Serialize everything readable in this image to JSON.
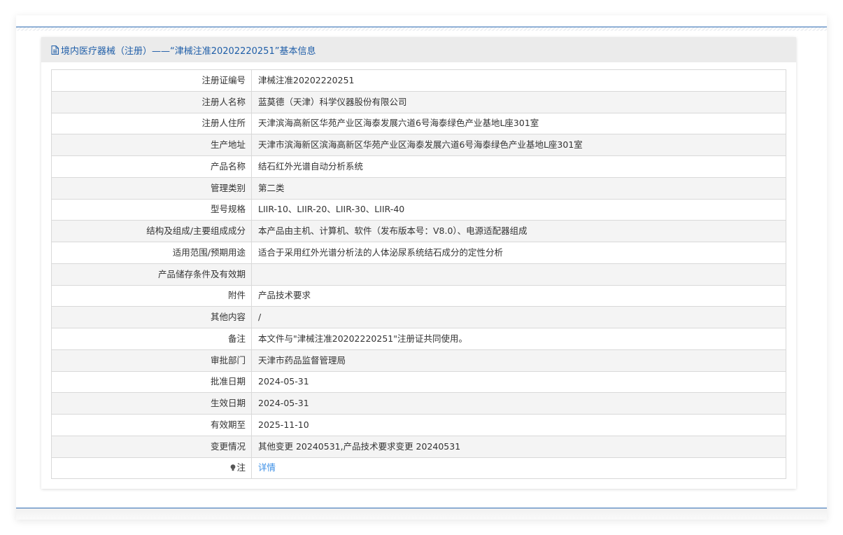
{
  "header": {
    "title": "境内医疗器械（注册）——“津械注准20202220251”基本信息"
  },
  "rows": [
    {
      "label": "注册证编号",
      "value": "津械注准20202220251"
    },
    {
      "label": "注册人名称",
      "value": "蓝莫德（天津）科学仪器股份有限公司"
    },
    {
      "label": "注册人住所",
      "value": "天津滨海高新区华苑产业区海泰发展六道6号海泰绿色产业基地L座301室"
    },
    {
      "label": "生产地址",
      "value": "天津市滨海新区滨海高新区华苑产业区海泰发展六道6号海泰绿色产业基地L座301室"
    },
    {
      "label": "产品名称",
      "value": "结石红外光谱自动分析系统"
    },
    {
      "label": "管理类别",
      "value": "第二类"
    },
    {
      "label": "型号规格",
      "value": "LIIR-10、LIIR-20、LIIR-30、LIIR-40"
    },
    {
      "label": "结构及组成/主要组成成分",
      "value": "本产品由主机、计算机、软件（发布版本号：V8.0）、电源适配器组成"
    },
    {
      "label": "适用范围/预期用途",
      "value": "适合于采用红外光谱分析法的人体泌尿系统结石成分的定性分析"
    },
    {
      "label": "产品储存条件及有效期",
      "value": ""
    },
    {
      "label": "附件",
      "value": "产品技术要求"
    },
    {
      "label": "其他内容",
      "value": "/"
    },
    {
      "label": "备注",
      "value": "本文件与\"津械注准20202220251\"注册证共同使用。"
    },
    {
      "label": "审批部门",
      "value": "天津市药品监督管理局"
    },
    {
      "label": "批准日期",
      "value": "2024-05-31"
    },
    {
      "label": "生效日期",
      "value": "2024-05-31"
    },
    {
      "label": "有效期至",
      "value": "2025-11-10"
    },
    {
      "label": "变更情况",
      "value": "其他变更 20240531,产品技术要求变更 20240531"
    }
  ],
  "note_row": {
    "icon": "bulb-icon",
    "label": "注",
    "link_text": "详情"
  },
  "colors": {
    "accent": "#1f5ea8",
    "link": "#3a8ee6",
    "header_bg": "#ebebeb",
    "row_alt": "#f4f4f4",
    "border": "#d9d9d9"
  }
}
